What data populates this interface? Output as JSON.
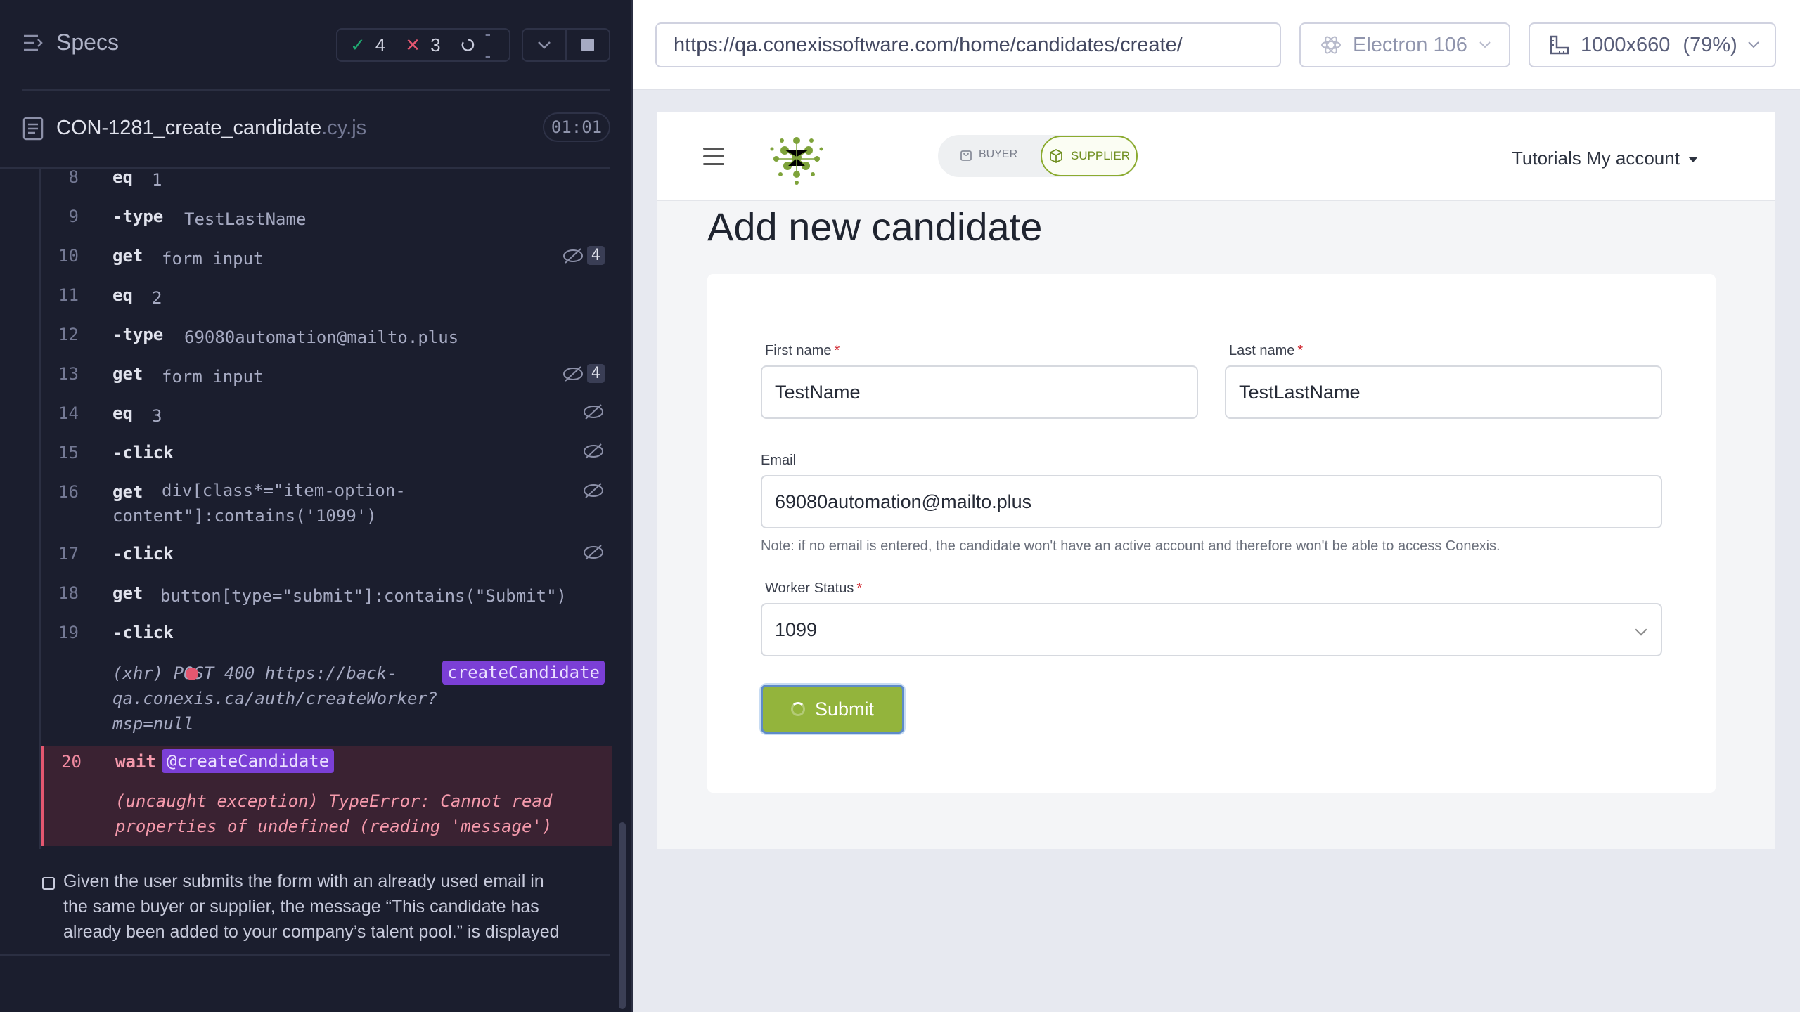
{
  "runner": {
    "specs_title": "Specs",
    "stats": {
      "passed": "4",
      "failed": "3",
      "pending": "--"
    },
    "file": {
      "name": "CON-1281_create_candidate",
      "ext": ".cy.js",
      "duration": "01:01"
    },
    "commands": [
      {
        "num": "8",
        "name": "eq",
        "msg": "1"
      },
      {
        "num": "9",
        "name": "-type",
        "msg": "TestLastName"
      },
      {
        "num": "10",
        "name": "get",
        "msg": "form input",
        "badge": "4"
      },
      {
        "num": "11",
        "name": "eq",
        "msg": "2"
      },
      {
        "num": "12",
        "name": "-type",
        "msg": "69080automation@mailto.plus"
      },
      {
        "num": "13",
        "name": "get",
        "msg": "form input",
        "badge": "4"
      },
      {
        "num": "14",
        "name": "eq",
        "msg": "3"
      },
      {
        "num": "15",
        "name": "-click",
        "msg": ""
      },
      {
        "num": "16",
        "name": "get",
        "msg": "div[class*=\"item-option-",
        "msg2": "content\"]:contains('1099')"
      },
      {
        "num": "17",
        "name": "-click",
        "msg": ""
      },
      {
        "num": "18",
        "name": "get",
        "msg": "button[type=\"submit\"]:contains(\"Submit\")"
      },
      {
        "num": "19",
        "name": "-click",
        "msg": ""
      }
    ],
    "xhr": {
      "line1": "(xhr)  POST 400 https://back-",
      "line2": "qa.conexis.ca/auth/createWorker?",
      "line3": "msp=null",
      "alias": "createCandidate",
      "status_color": "#e45770"
    },
    "error_cmd": {
      "num": "20",
      "name": "wait",
      "alias": "@createCandidate",
      "line1": "(uncaught exception)  TypeError: Cannot read",
      "line2": "properties of undefined (reading 'message')"
    },
    "pending_test": {
      "line1": "Given the user submits the form with an already used email in",
      "line2": "the same buyer or supplier, the message “This candidate has",
      "line3": "already been added to your company’s talent pool.” is displayed"
    }
  },
  "browser": {
    "url": "https://qa.conexissoftware.com/home/candidates/create/",
    "name": "Electron 106",
    "viewport": "1000x660",
    "zoom": "(79%)"
  },
  "app": {
    "toggle": {
      "buyer": "BUYER",
      "supplier": "SUPPLIER"
    },
    "nav": {
      "tutorials": "Tutorials",
      "account": "My account"
    },
    "page_title": "Add new candidate",
    "form": {
      "first_name_label": "First name",
      "first_name_value": "TestName",
      "last_name_label": "Last name",
      "last_name_value": "TestLastName",
      "email_label": "Email",
      "email_value": "69080automation@mailto.plus",
      "note": "Note: if no email is entered, the candidate won't have an active account and therefore won't be able to access Conexis.",
      "worker_status_label": "Worker Status",
      "worker_status_value": "1099",
      "required_mark": "*",
      "submit_label": "Submit"
    },
    "brand_color": "#93b43c"
  }
}
